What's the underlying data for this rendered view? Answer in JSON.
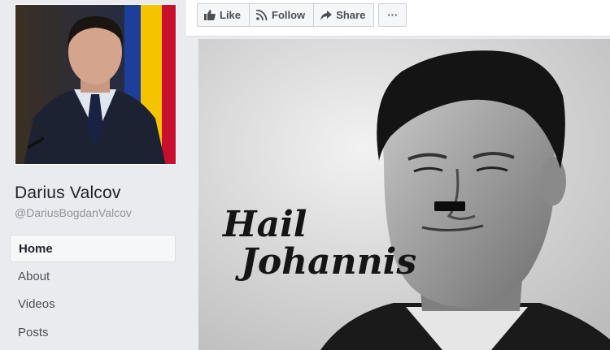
{
  "profile": {
    "name": "Darius Valcov",
    "handle": "@DariusBogdanValcov",
    "photo_alt": "profile-photo"
  },
  "nav": {
    "items": [
      {
        "label": "Home",
        "active": true
      },
      {
        "label": "About",
        "active": false
      },
      {
        "label": "Videos",
        "active": false
      },
      {
        "label": "Posts",
        "active": false
      }
    ]
  },
  "actions": {
    "like_label": "Like",
    "follow_label": "Follow",
    "share_label": "Share",
    "more_label": "···"
  },
  "post_image": {
    "caption_line1": "Hail",
    "caption_line2": "Johannis"
  },
  "colors": {
    "page_bg": "#e9ebee",
    "text_primary": "#1d2129",
    "text_secondary": "#90949c",
    "flag_blue": "#1d3f9a",
    "flag_yellow": "#f5c400",
    "flag_red": "#c8102e"
  }
}
